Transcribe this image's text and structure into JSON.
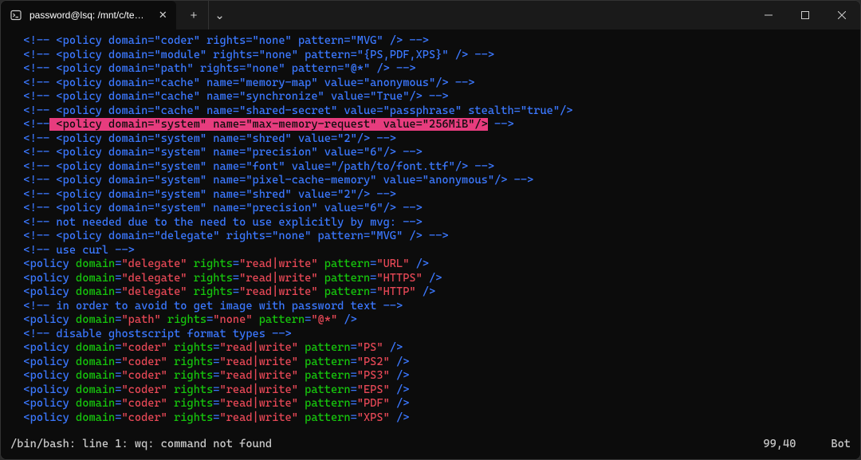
{
  "titlebar": {
    "tab_title": "password@lsq: /mnt/c/test/te",
    "close_label": "✕",
    "new_tab": "+",
    "dropdown": "⌄"
  },
  "winctrl": {
    "minimize": "—",
    "maximize": "☐",
    "close": "✕"
  },
  "lines": [
    {
      "type": "comment",
      "text": "  <!-- <policy domain=\"coder\" rights=\"none\" pattern=\"MVG\" /> -->"
    },
    {
      "type": "comment",
      "text": "  <!-- <policy domain=\"module\" rights=\"none\" pattern=\"{PS,PDF,XPS}\" /> -->"
    },
    {
      "type": "comment",
      "text": "  <!-- <policy domain=\"path\" rights=\"none\" pattern=\"@*\" /> -->"
    },
    {
      "type": "comment",
      "text": "  <!-- <policy domain=\"cache\" name=\"memory-map\" value=\"anonymous\"/> -->"
    },
    {
      "type": "comment",
      "text": "  <!-- <policy domain=\"cache\" name=\"synchronize\" value=\"True\"/> -->"
    },
    {
      "type": "comment",
      "text": "  <!-- <policy domain=\"cache\" name=\"shared-secret\" value=\"passphrase\" stealth=\"true\"/>"
    },
    {
      "type": "highlight",
      "prefix": "  <!--",
      "highlight": " <policy domain=\"system\" name=\"max-memory-request\" value=\"256MiB\"/>",
      "suffix": " -->"
    },
    {
      "type": "comment",
      "text": "  <!-- <policy domain=\"system\" name=\"shred\" value=\"2\"/> -->"
    },
    {
      "type": "comment",
      "text": "  <!-- <policy domain=\"system\" name=\"precision\" value=\"6\"/> -->"
    },
    {
      "type": "comment",
      "text": "  <!-- <policy domain=\"system\" name=\"font\" value=\"/path/to/font.ttf\"/> -->"
    },
    {
      "type": "comment",
      "text": "  <!-- <policy domain=\"system\" name=\"pixel-cache-memory\" value=\"anonymous\"/> -->"
    },
    {
      "type": "comment",
      "text": "  <!-- <policy domain=\"system\" name=\"shred\" value=\"2\"/> -->"
    },
    {
      "type": "comment",
      "text": "  <!-- <policy domain=\"system\" name=\"precision\" value=\"6\"/> -->"
    },
    {
      "type": "comment",
      "text": "  <!-- not needed due to the need to use explicitly by mvg: -->"
    },
    {
      "type": "comment",
      "text": "  <!-- <policy domain=\"delegate\" rights=\"none\" pattern=\"MVG\" /> -->"
    },
    {
      "type": "comment",
      "text": "  <!-- use curl -->"
    },
    {
      "type": "policy",
      "domain": "delegate",
      "rights": "read|write",
      "pattern": "URL"
    },
    {
      "type": "policy",
      "domain": "delegate",
      "rights": "read|write",
      "pattern": "HTTPS"
    },
    {
      "type": "policy",
      "domain": "delegate",
      "rights": "read|write",
      "pattern": "HTTP"
    },
    {
      "type": "comment",
      "text": "  <!-- in order to avoid to get image with password text -->"
    },
    {
      "type": "policy",
      "domain": "path",
      "rights": "none",
      "pattern": "@*"
    },
    {
      "type": "comment",
      "text": "  <!-- disable ghostscript format types -->"
    },
    {
      "type": "policy",
      "domain": "coder",
      "rights": "read|write",
      "pattern": "PS"
    },
    {
      "type": "policy",
      "domain": "coder",
      "rights": "read|write",
      "pattern": "PS2"
    },
    {
      "type": "policy",
      "domain": "coder",
      "rights": "read|write",
      "pattern": "PS3"
    },
    {
      "type": "policy",
      "domain": "coder",
      "rights": "read|write",
      "pattern": "EPS"
    },
    {
      "type": "policy",
      "domain": "coder",
      "rights": "read|write",
      "pattern": "PDF"
    },
    {
      "type": "policy",
      "domain": "coder",
      "rights": "read|write",
      "pattern": "XPS"
    }
  ],
  "status": {
    "left": "/bin/bash: line 1: wq: command not found",
    "position": "99,40",
    "scroll": "Bot"
  }
}
